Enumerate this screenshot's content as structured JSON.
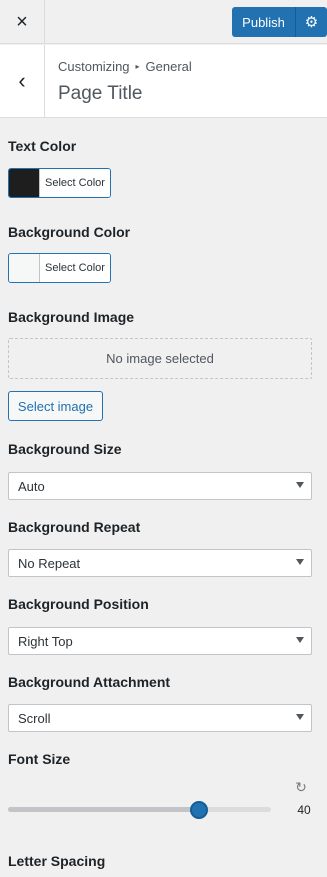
{
  "header": {
    "close_icon": "×",
    "publish_label": "Publish",
    "settings_icon": "⚙"
  },
  "section": {
    "back_icon": "‹",
    "breadcrumb_parent": "Customizing",
    "breadcrumb_separator": "▸",
    "breadcrumb_child": "General",
    "title": "Page Title"
  },
  "controls": {
    "text_color": {
      "label": "Text Color",
      "button_label": "Select Color",
      "swatch": "#1e1e1e"
    },
    "background_color": {
      "label": "Background Color",
      "button_label": "Select Color",
      "swatch": "#f6f7f7"
    },
    "background_image": {
      "label": "Background Image",
      "placeholder": "No image selected",
      "button_label": "Select image"
    },
    "background_size": {
      "label": "Background Size",
      "value": "Auto"
    },
    "background_repeat": {
      "label": "Background Repeat",
      "value": "No Repeat"
    },
    "background_position": {
      "label": "Background Position",
      "value": "Right Top"
    },
    "background_attachment": {
      "label": "Background Attachment",
      "value": "Scroll"
    },
    "font_size": {
      "label": "Font Size",
      "reset_icon": "↻",
      "value": "40",
      "slider_fraction": 0.725
    },
    "letter_spacing": {
      "label": "Letter Spacing"
    }
  },
  "colors": {
    "accent": "#2271b1",
    "background": "#f0f0f1"
  }
}
